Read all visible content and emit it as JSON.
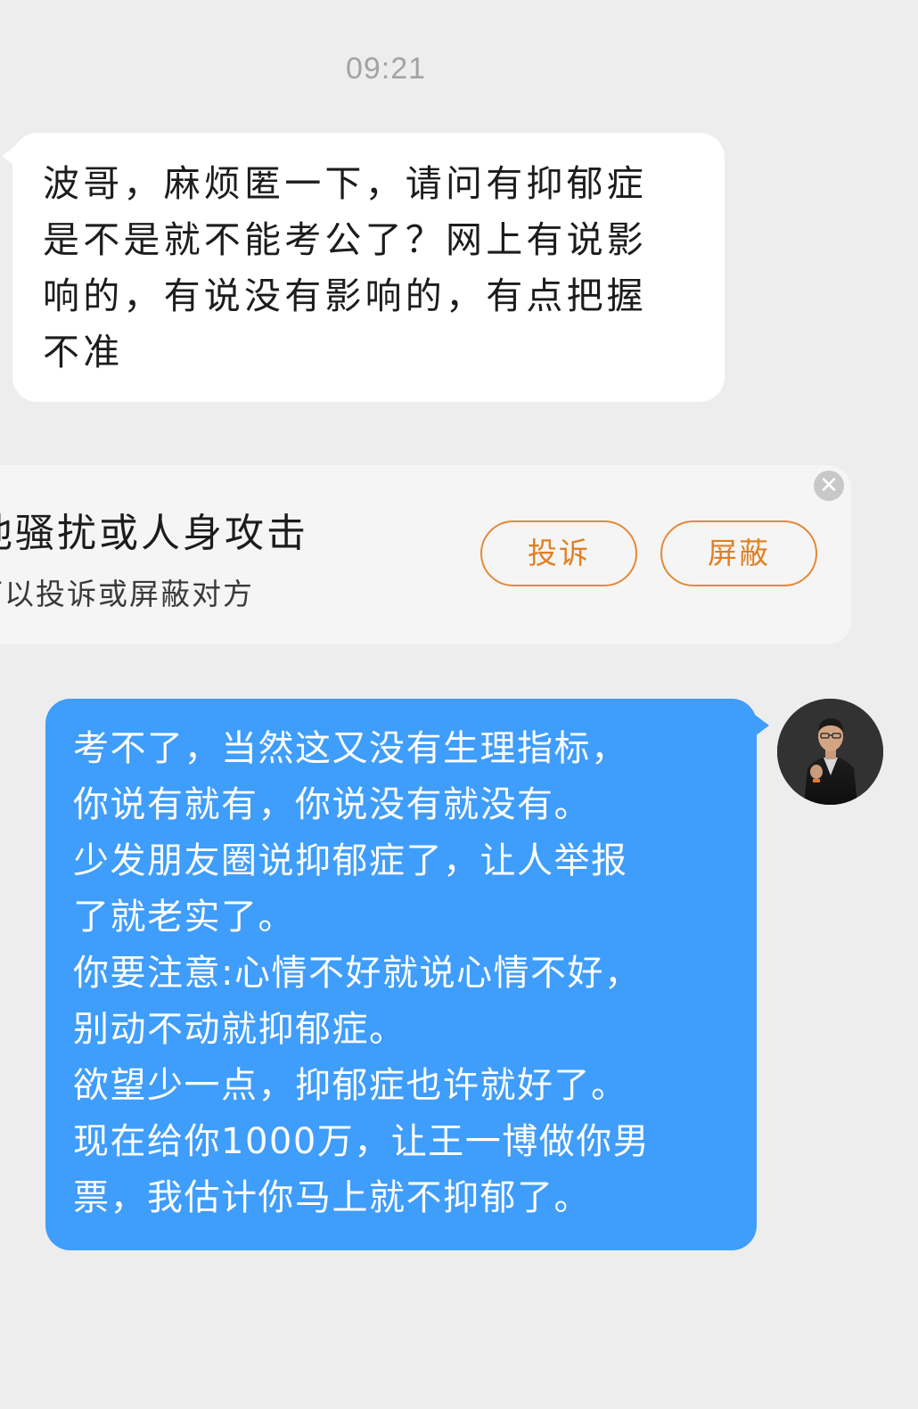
{
  "chat": {
    "timestamp": "09:21",
    "incoming_message": {
      "text": "波哥，麻烦匿一下，请问有抑郁症\n是不是就不能考公了？网上有说影\n响的，有说没有影响的，有点把握\n不准"
    },
    "safety_notice": {
      "title": "他骚扰或人身攻击",
      "subtitle": "可以投诉或屏蔽对方",
      "complain_label": "投诉",
      "block_label": "屏蔽",
      "close_glyph": "✕"
    },
    "outgoing_message": {
      "text": "考不了，当然这又没有生理指标，\n你说有就有，你说没有就没有。\n少发朋友圈说抑郁症了，让人举报\n了就老实了。\n你要注意:心情不好就说心情不好，\n别动不动就抑郁症。\n欲望少一点，抑郁症也许就好了。\n现在给你1000万，让王一博做你男\n票，我估计你马上就不抑郁了。"
    }
  },
  "colors": {
    "background": "#ededed",
    "incoming_bubble": "#ffffff",
    "outgoing_bubble": "#3f9dfb",
    "accent_orange": "#e08023",
    "timestamp_gray": "#a3a3a3"
  },
  "icons": {
    "close": "close-icon",
    "avatar": "user-avatar"
  }
}
